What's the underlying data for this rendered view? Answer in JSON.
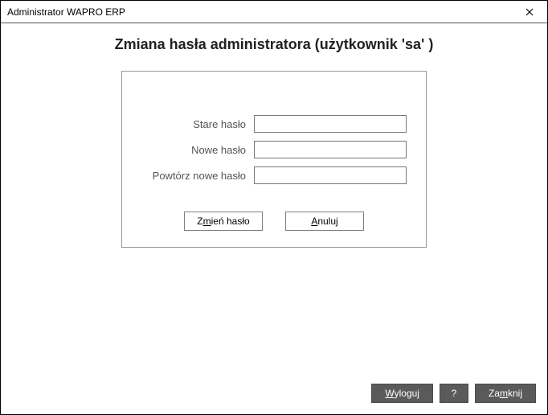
{
  "window": {
    "title": "Administrator WAPRO ERP"
  },
  "heading": "Zmiana hasła administratora (użytkownik 'sa' )",
  "form": {
    "old_password_label": "Stare hasło",
    "new_password_label": "Nowe hasło",
    "repeat_password_label": "Powtórz nowe hasło",
    "old_password_value": "",
    "new_password_value": "",
    "repeat_password_value": ""
  },
  "panel_buttons": {
    "change_prefix": "Z",
    "change_underline": "m",
    "change_suffix": "ień hasło",
    "cancel_underline": "A",
    "cancel_suffix": "nuluj"
  },
  "footer": {
    "logout_underline": "W",
    "logout_suffix": "yloguj",
    "help": "?",
    "close_prefix": "Za",
    "close_underline": "m",
    "close_suffix": "knij"
  }
}
